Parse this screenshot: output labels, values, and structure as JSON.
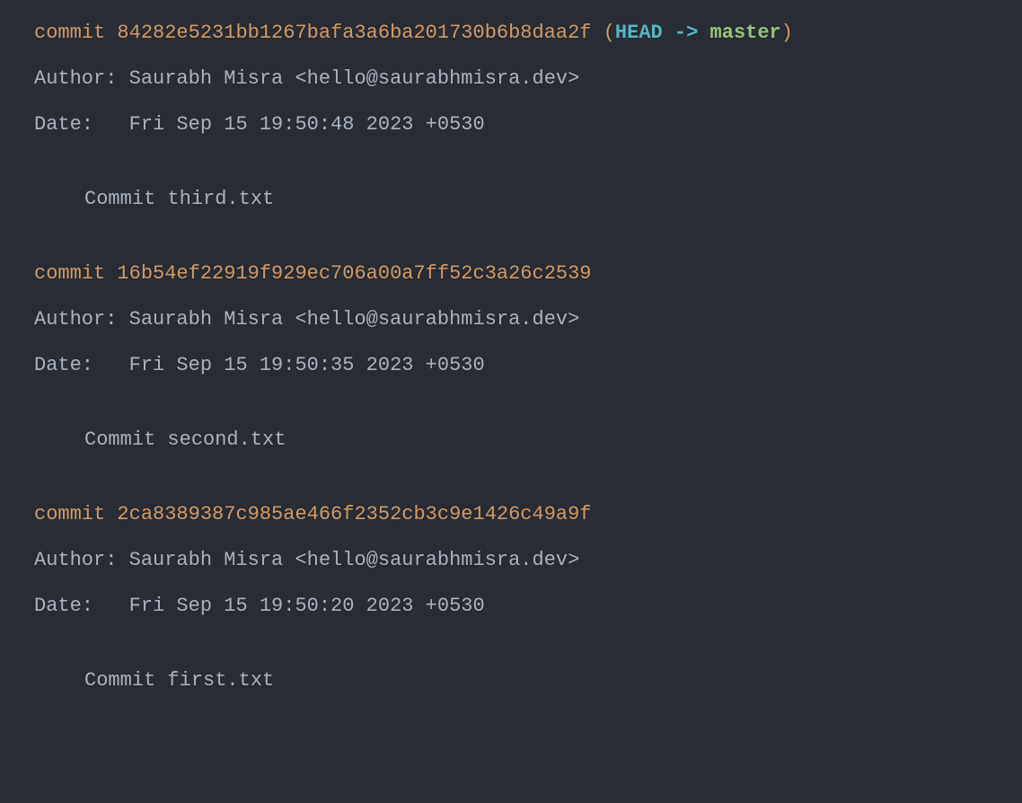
{
  "commits": [
    {
      "keyword": "commit",
      "hash": "84282e5231bb1267bafa3a6ba201730b6b8daa2f",
      "has_refs": true,
      "refs": {
        "open_paren": " (",
        "head": "HEAD",
        "arrow": " -> ",
        "branch": "master",
        "close_paren": ")"
      },
      "author_label": "Author: ",
      "author_value": "Saurabh Misra <hello@saurabhmisra.dev>",
      "date_label": "Date:   ",
      "date_value": "Fri Sep 15 19:50:48 2023 +0530",
      "message": "Commit third.txt"
    },
    {
      "keyword": "commit",
      "hash": "16b54ef22919f929ec706a00a7ff52c3a26c2539",
      "has_refs": false,
      "author_label": "Author: ",
      "author_value": "Saurabh Misra <hello@saurabhmisra.dev>",
      "date_label": "Date:   ",
      "date_value": "Fri Sep 15 19:50:35 2023 +0530",
      "message": "Commit second.txt"
    },
    {
      "keyword": "commit",
      "hash": "2ca8389387c985ae466f2352cb3c9e1426c49a9f",
      "has_refs": false,
      "author_label": "Author: ",
      "author_value": "Saurabh Misra <hello@saurabhmisra.dev>",
      "date_label": "Date:   ",
      "date_value": "Fri Sep 15 19:50:20 2023 +0530",
      "message": "Commit first.txt"
    }
  ]
}
